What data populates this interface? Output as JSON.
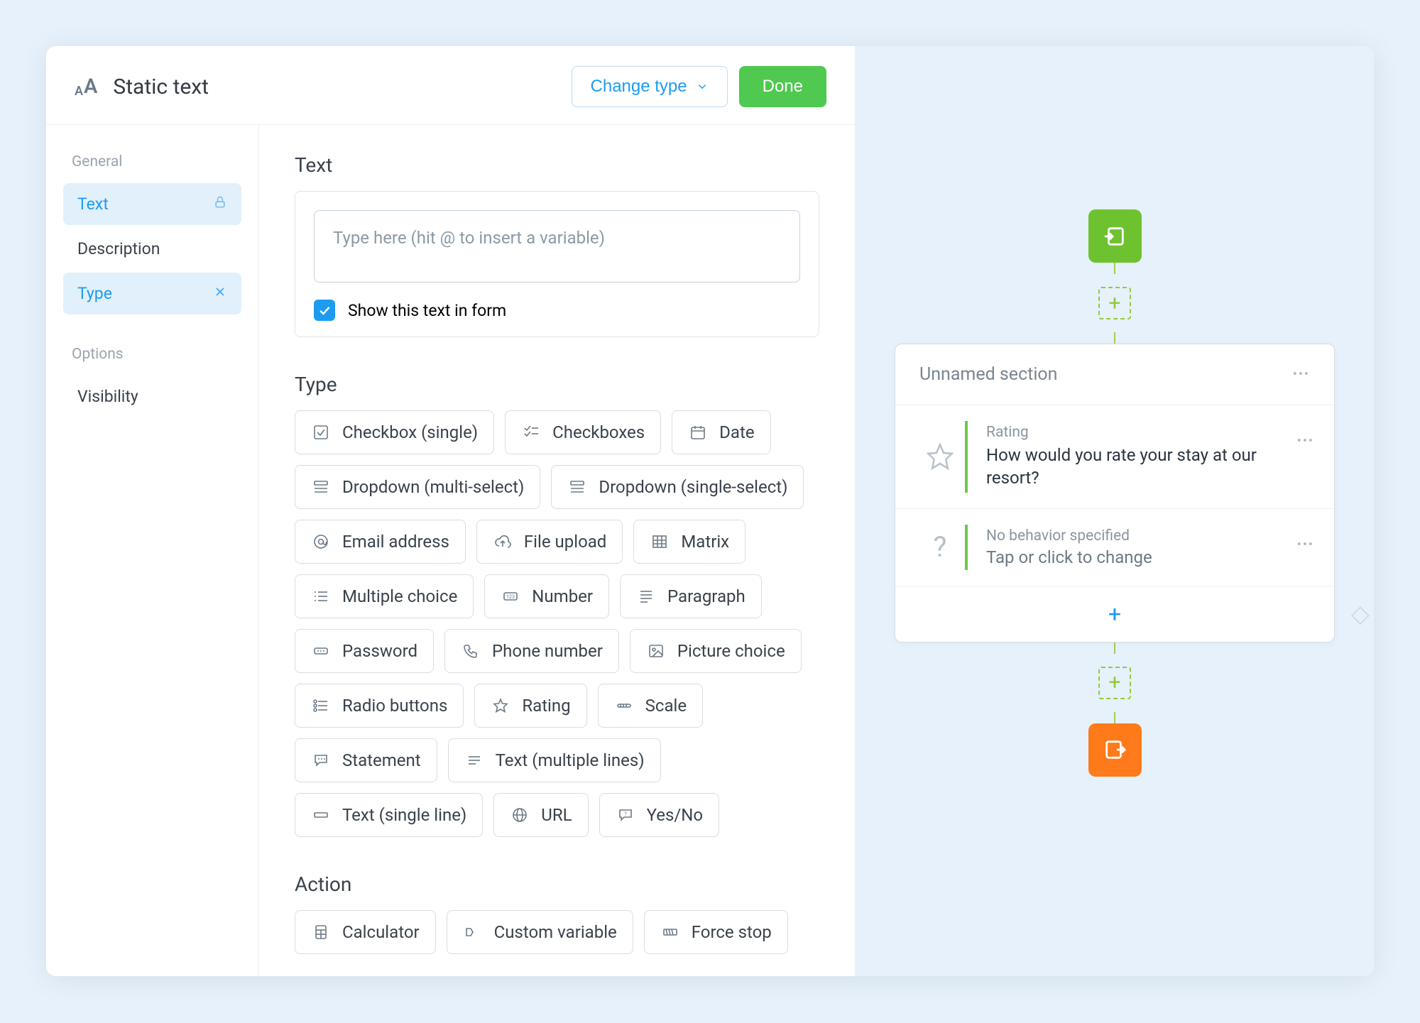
{
  "header": {
    "title": "Static text",
    "change_type": "Change type",
    "done": "Done"
  },
  "sidebar": {
    "general_label": "General",
    "options_label": "Options",
    "items": {
      "text": "Text",
      "description": "Description",
      "type": "Type",
      "visibility": "Visibility"
    }
  },
  "text_section": {
    "heading": "Text",
    "placeholder": "Type here (hit @ to insert a variable)",
    "show_in_form": "Show this text in form"
  },
  "type_section": {
    "heading": "Type",
    "options": [
      "Checkbox (single)",
      "Checkboxes",
      "Date",
      "Dropdown (multi-select)",
      "Dropdown (single-select)",
      "Email address",
      "File upload",
      "Matrix",
      "Multiple choice",
      "Number",
      "Paragraph",
      "Password",
      "Phone number",
      "Picture choice",
      "Radio buttons",
      "Rating",
      "Scale",
      "Statement",
      "Text (multiple lines)",
      "Text (single line)",
      "URL",
      "Yes/No"
    ]
  },
  "action_section": {
    "heading": "Action",
    "options": [
      "Calculator",
      "Custom variable",
      "Force stop"
    ]
  },
  "canvas": {
    "section_name": "Unnamed section",
    "q1_label": "Rating",
    "q1_title": "How would you rate your stay at our resort?",
    "q2_label": "No behavior specified",
    "q2_placeholder": "Tap or click to change",
    "add": "+"
  }
}
